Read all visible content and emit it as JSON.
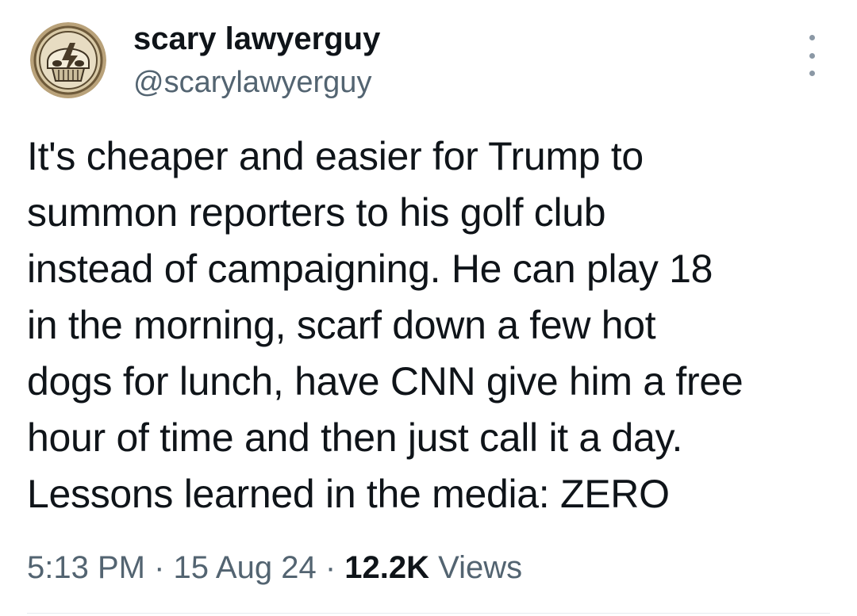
{
  "user": {
    "display_name": "scary lawyerguy",
    "handle": "@scarylawyerguy",
    "avatar_icon": "skull-lightning-bolt-icon"
  },
  "more_menu_icon": "more-vertical-icon",
  "tweet": {
    "lines": [
      "It's cheaper and easier for Trump to",
      "summon reporters to his golf club",
      "instead of campaigning. He can play 18",
      "in the morning, scarf down a few hot",
      "dogs for lunch, have CNN give him a free",
      "hour of time and then just call it a day.",
      "Lessons learned in the media: ZERO"
    ]
  },
  "meta": {
    "time": "5:13 PM",
    "separator": " · ",
    "date": "15 Aug 24",
    "views_count": "12.2K",
    "views_label": "Views"
  },
  "colors": {
    "text_primary": "#0f1419",
    "text_secondary": "#536471",
    "divider": "#e6ecf0"
  }
}
